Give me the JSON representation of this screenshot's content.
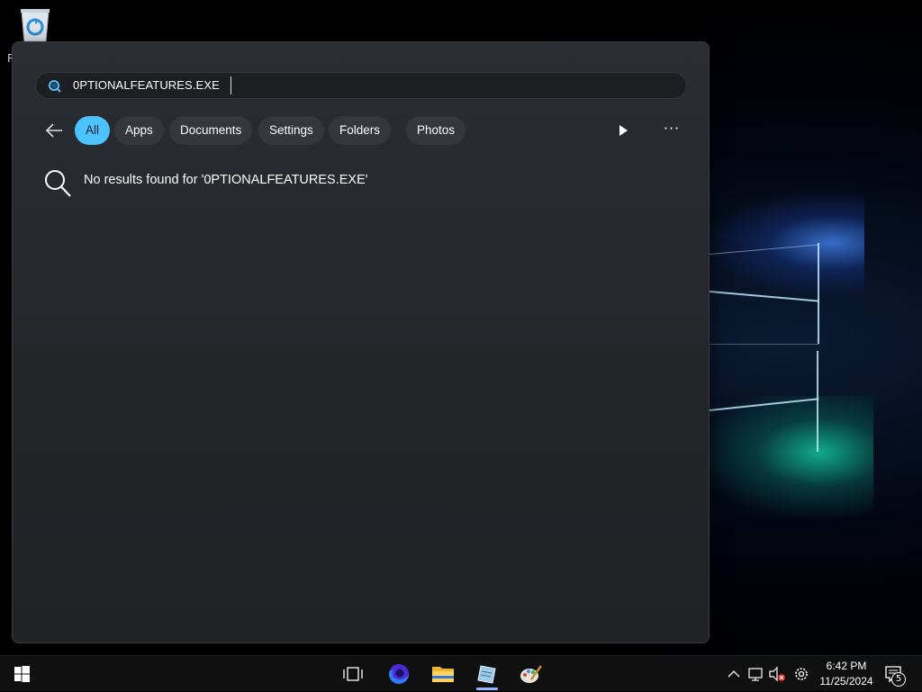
{
  "desktop": {
    "recycle_bin_label": "R",
    "accent_color": "#4cc2ff"
  },
  "search": {
    "query": "0PTIONALFEATURES.EXE",
    "filters": [
      {
        "label": "All",
        "active": true
      },
      {
        "label": "Apps",
        "active": false
      },
      {
        "label": "Documents",
        "active": false
      },
      {
        "label": "Settings",
        "active": false
      },
      {
        "label": "Folders",
        "active": false
      },
      {
        "label": "Photos",
        "active": false
      }
    ],
    "more_label": "···",
    "no_results_text": "No results found for '0PTIONALFEATURES.EXE'"
  },
  "taskbar": {
    "apps": [
      "start-icon",
      "task-view-icon",
      "firefox-icon",
      "file-explorer-icon",
      "notepad-icon",
      "paint-icon"
    ],
    "tray": [
      "chevron-up-icon",
      "network-icon",
      "volume-muted-icon",
      "settings-gear-icon"
    ],
    "time": "6:42 PM",
    "date": "11/25/2024",
    "notification_count": "5"
  }
}
